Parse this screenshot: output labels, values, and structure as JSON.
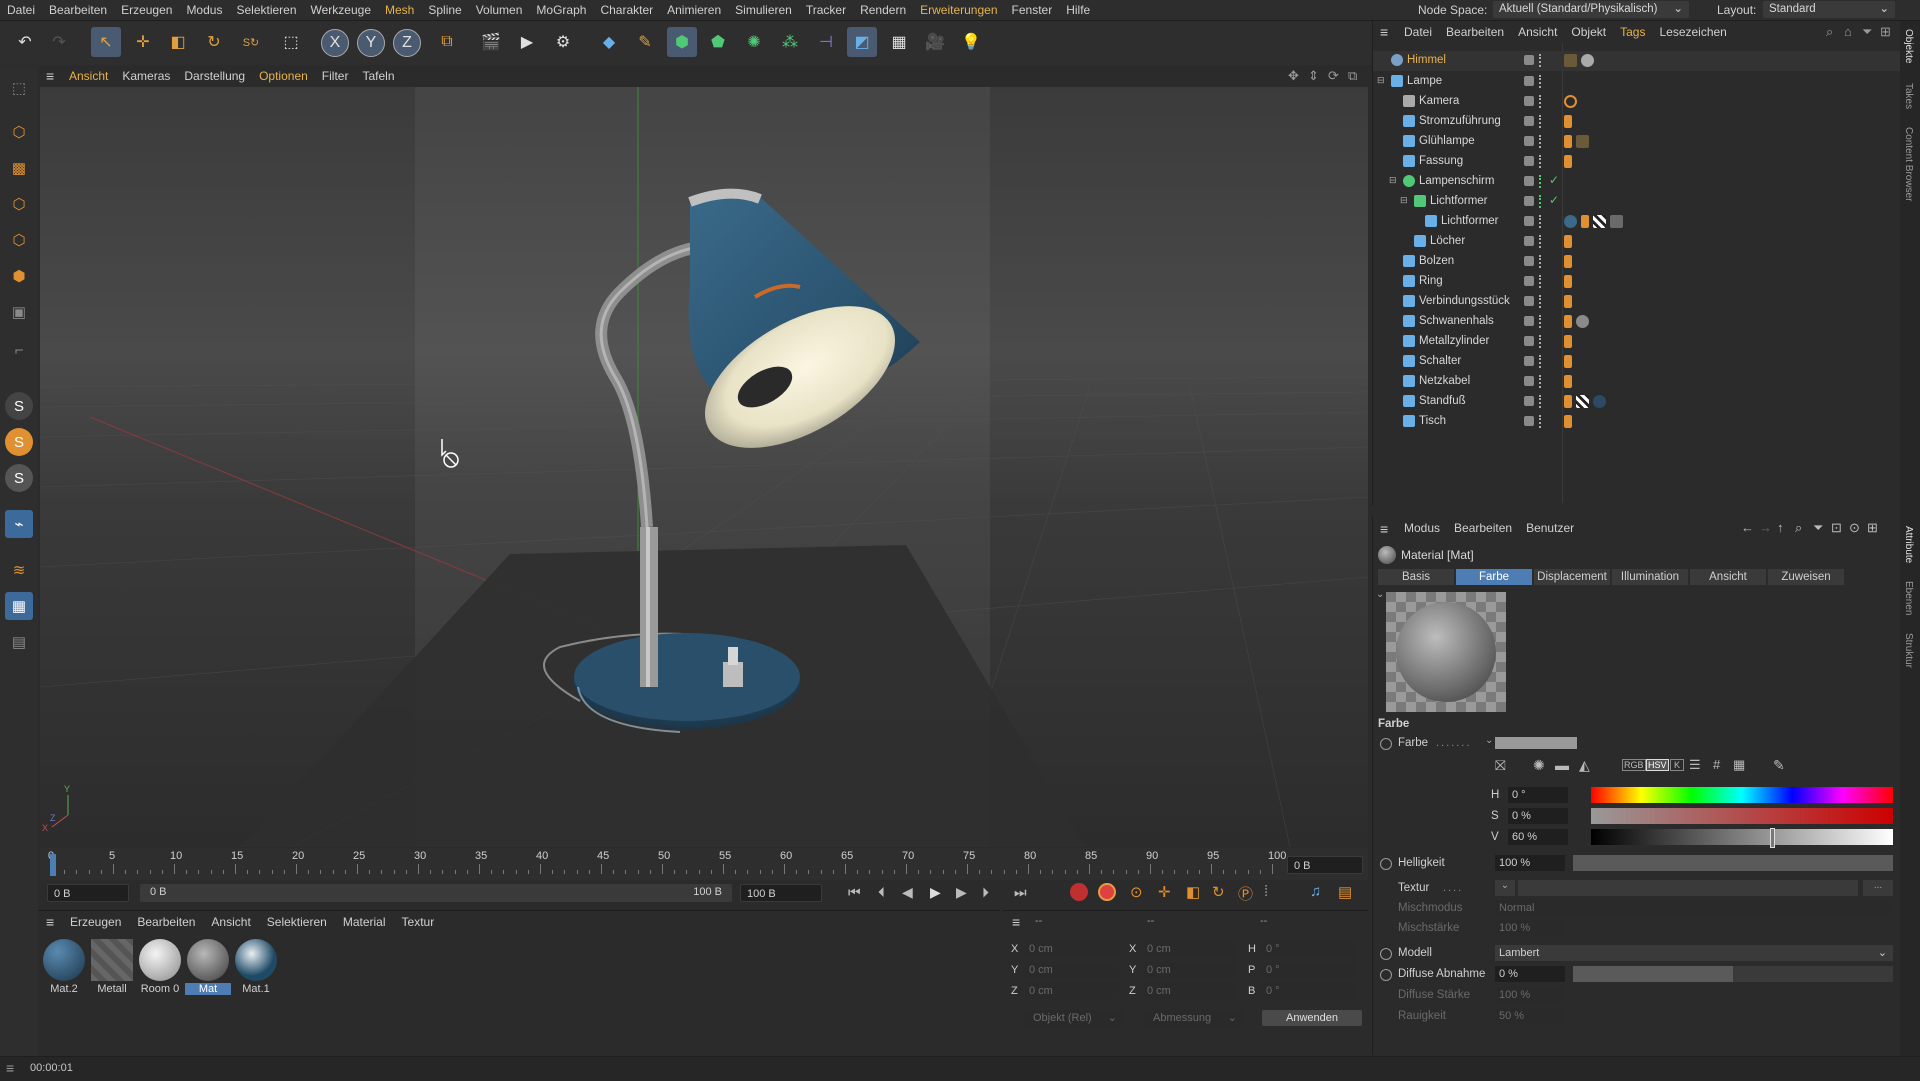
{
  "menubar": {
    "items": [
      "Datei",
      "Bearbeiten",
      "Erzeugen",
      "Modus",
      "Selektieren",
      "Werkzeuge",
      "Mesh",
      "Spline",
      "Volumen",
      "MoGraph",
      "Charakter",
      "Animieren",
      "Simulieren",
      "Tracker",
      "Rendern",
      "Erweiterungen",
      "Fenster",
      "Hilfe"
    ],
    "node_space_label": "Node Space:",
    "node_space_value": "Aktuell (Standard/Physikalisch)",
    "layout_label": "Layout:",
    "layout_value": "Standard"
  },
  "toolbar": {
    "axis_x": "X",
    "axis_y": "Y",
    "axis_z": "Z"
  },
  "viewport": {
    "menus": [
      "Ansicht",
      "Kameras",
      "Darstellung",
      "Optionen",
      "Filter",
      "Tafeln"
    ],
    "axis_y_label": "Y",
    "axis_x_label": "X",
    "axis_z_label": "Z"
  },
  "timeline": {
    "ticks": [
      "0",
      "5",
      "10",
      "15",
      "20",
      "25",
      "30",
      "35",
      "40",
      "45",
      "50",
      "55",
      "60",
      "65",
      "70",
      "75",
      "80",
      "85",
      "90",
      "95",
      "100"
    ],
    "current_frame": "0 B",
    "start_field": "0 B",
    "range_start": "0 B",
    "range_end": "100 B",
    "end_field": "100 B"
  },
  "material_manager": {
    "menus": [
      "Erzeugen",
      "Bearbeiten",
      "Ansicht",
      "Selektieren",
      "Material",
      "Textur"
    ],
    "materials": [
      {
        "label": "Mat.2",
        "color": "#2a4a66"
      },
      {
        "label": "Metall",
        "color": "#6a6a6a"
      },
      {
        "label": "Room 0",
        "color": "#cfcfcf"
      },
      {
        "label": "Mat",
        "color": "#8a8a8a"
      },
      {
        "label": "Mat.1",
        "color": "#3a6a8a"
      }
    ],
    "selected": "Mat"
  },
  "coordinates": {
    "header_left": "--",
    "header_mid": "--",
    "header_right": "--",
    "pos_x_label": "X",
    "pos_x": "0 cm",
    "pos_y_label": "Y",
    "pos_y": "0 cm",
    "pos_z_label": "Z",
    "pos_z": "0 cm",
    "size_x_label": "X",
    "size_x": "0 cm",
    "size_y_label": "Y",
    "size_y": "0 cm",
    "size_z_label": "Z",
    "size_z": "0 cm",
    "rot_h_label": "H",
    "rot_h": "0 °",
    "rot_p_label": "P",
    "rot_p": "0 °",
    "rot_b_label": "B",
    "rot_b": "0 °",
    "mode_select": "Objekt (Rel)",
    "size_select": "Abmessung",
    "apply_button": "Anwenden"
  },
  "status": {
    "time": "00:00:01"
  },
  "object_manager": {
    "menus": [
      "Datei",
      "Bearbeiten",
      "Ansicht",
      "Objekt",
      "Tags",
      "Lesezeichen"
    ],
    "objects": [
      {
        "name": "Himmel",
        "indent": 0,
        "highlight": true
      },
      {
        "name": "Lampe",
        "indent": 0
      },
      {
        "name": "Kamera",
        "indent": 1
      },
      {
        "name": "Stromzuführung",
        "indent": 1
      },
      {
        "name": "Glühlampe",
        "indent": 1
      },
      {
        "name": "Fassung",
        "indent": 1
      },
      {
        "name": "Lampenschirm",
        "indent": 1
      },
      {
        "name": "Lichtformer",
        "indent": 2
      },
      {
        "name": "Lichtformer",
        "indent": 3
      },
      {
        "name": "Löcher",
        "indent": 2
      },
      {
        "name": "Bolzen",
        "indent": 1
      },
      {
        "name": "Ring",
        "indent": 1
      },
      {
        "name": "Verbindungsstück",
        "indent": 1
      },
      {
        "name": "Schwanenhals",
        "indent": 1
      },
      {
        "name": "Metallzylinder",
        "indent": 1
      },
      {
        "name": "Schalter",
        "indent": 1
      },
      {
        "name": "Netzkabel",
        "indent": 1
      },
      {
        "name": "Standfuß",
        "indent": 1
      },
      {
        "name": "Tisch",
        "indent": 1
      }
    ]
  },
  "attribute_manager": {
    "menus": [
      "Modus",
      "Bearbeiten",
      "Benutzer"
    ],
    "title": "Material [Mat]",
    "tabs": [
      "Basis",
      "Farbe",
      "Displacement",
      "Illumination",
      "Ansicht",
      "Zuweisen"
    ],
    "active_tab": "Farbe",
    "section": "Farbe",
    "farbe_label": "Farbe",
    "color_mode_rgb": "RGB",
    "color_mode_hsv": "HSV",
    "color_mode_k": "K",
    "h_label": "H",
    "h_value": "0 °",
    "s_label": "S",
    "s_value": "0 %",
    "v_label": "V",
    "v_value": "60 %",
    "v_fraction": 0.6,
    "helligkeit_label": "Helligkeit",
    "helligkeit_value": "100 %",
    "textur_label": "Textur",
    "mischmodus_label": "Mischmodus",
    "mischmodus_value": "Normal",
    "mischstaerke_label": "Mischstärke",
    "mischstaerke_value": "100 %",
    "modell_label": "Modell",
    "modell_value": "Lambert",
    "diffuse_abnahme_label": "Diffuse Abnahme",
    "diffuse_abnahme_value": "0 %",
    "diffuse_staerke_label": "Diffuse Stärke",
    "diffuse_staerke_value": "100 %",
    "rauigkeit_label": "Rauigkeit",
    "rauigkeit_value": "50 %"
  },
  "side_tabs": [
    "Objekte",
    "Takes",
    "Content Browser",
    "Attribute",
    "Ebenen",
    "Struktur"
  ]
}
